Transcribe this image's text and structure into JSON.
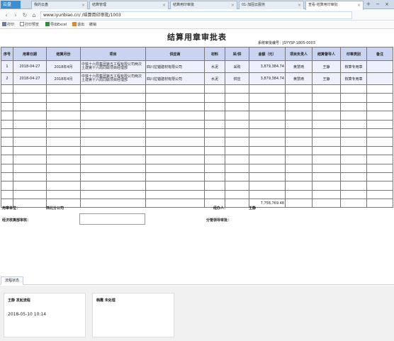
{
  "browser": {
    "brand": "云盘",
    "tabs": [
      {
        "label": "我的云盘",
        "active": false
      },
      {
        "label": "结算管理",
        "active": false
      },
      {
        "label": "结算用印审批",
        "active": false
      },
      {
        "label": "01-加固云服务",
        "active": false
      },
      {
        "label": "查看·结算用印审批",
        "active": true
      }
    ],
    "new_tab": "+",
    "url": "www.iyunbiao.cn/          /结算用印审批/1003"
  },
  "toolbar": {
    "print": "打印",
    "print_preview": "打印预览",
    "export_excel": "导出Excel",
    "exit": "退出",
    "revoke": "撤销"
  },
  "form": {
    "title": "结算用章审批表",
    "system_no_label": "系统审批编号",
    "system_no": "JSYYSP-1805-0003",
    "columns": [
      "序号",
      "用章日期",
      "结算月份",
      "项目",
      "供应商",
      "材料",
      "采/供",
      "金额（元）",
      "项目负责人",
      "结算督导人",
      "印章类别",
      "备注"
    ],
    "rows": [
      {
        "no": "1",
        "date": "2018-04-27",
        "month": "2018年4月",
        "project": "中铁十六局集团第五工程有限公司两次土建第十六局同联项目经理部",
        "supplier": "四川拉锚建材有限公司",
        "material": "水泥",
        "type": "采购",
        "amount": "3,879,384.74",
        "pm": "黄慧琦",
        "supervisor": "王静",
        "seal": "核算专用章",
        "remark": ""
      },
      {
        "no": "2",
        "date": "2018-04-27",
        "month": "2018年4月",
        "project": "中铁十六局集团第五工程有限公司两次土建第十六局同联项目经理部",
        "supplier": "四川拉锚建材有限公司",
        "material": "水泥",
        "type": "供应",
        "amount": "3,879,384.74",
        "pm": "黄慧琦",
        "supervisor": "王静",
        "seal": "核算专用章",
        "remark": ""
      }
    ],
    "total": "7,758,769.48",
    "unit_label": "用章单位：",
    "unit_value": "西北分公司",
    "handler_label": "经办人：",
    "handler_value": "王静",
    "dept_review_label": "经济核算部审核：",
    "leader_review_label": "分管领导审批："
  },
  "flow": {
    "tab_label": "流程状态",
    "cards": [
      {
        "header": "王静  发起流程",
        "date": "2018-05-10 10:14"
      },
      {
        "header": "韩霞  未处理",
        "date": ""
      }
    ]
  },
  "colors": {
    "header_bg": "#c8d4f0",
    "row_bg": "#eef1fb",
    "tabbar": "#cfdbe9"
  }
}
